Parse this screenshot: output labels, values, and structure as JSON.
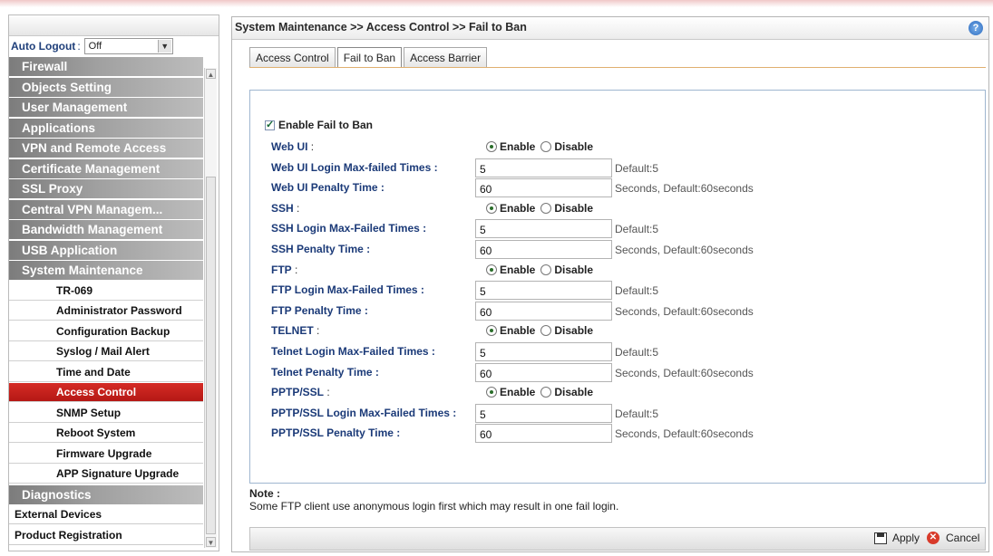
{
  "sidebar": {
    "auto_logout_label": "Auto Logout",
    "auto_logout_value": "Off",
    "menu": [
      {
        "label": "Firewall",
        "kind": "group"
      },
      {
        "label": "Objects Setting",
        "kind": "group"
      },
      {
        "label": "User Management",
        "kind": "group"
      },
      {
        "label": "Applications",
        "kind": "group"
      },
      {
        "label": "VPN and Remote Access",
        "kind": "group"
      },
      {
        "label": "Certificate Management",
        "kind": "group"
      },
      {
        "label": "SSL Proxy",
        "kind": "group"
      },
      {
        "label": "Central VPN Managem...",
        "kind": "group"
      },
      {
        "label": "Bandwidth Management",
        "kind": "group"
      },
      {
        "label": "USB Application",
        "kind": "group"
      },
      {
        "label": "System Maintenance",
        "kind": "group"
      },
      {
        "label": "TR-069",
        "kind": "sub"
      },
      {
        "label": "Administrator Password",
        "kind": "sub"
      },
      {
        "label": "Configuration Backup",
        "kind": "sub"
      },
      {
        "label": "Syslog / Mail Alert",
        "kind": "sub"
      },
      {
        "label": "Time and Date",
        "kind": "sub"
      },
      {
        "label": "Access Control",
        "kind": "sub",
        "active": true
      },
      {
        "label": "SNMP Setup",
        "kind": "sub"
      },
      {
        "label": "Reboot System",
        "kind": "sub"
      },
      {
        "label": "Firmware Upgrade",
        "kind": "sub"
      },
      {
        "label": "APP Signature Upgrade",
        "kind": "sub"
      },
      {
        "label": "Diagnostics",
        "kind": "group"
      },
      {
        "label": "External Devices",
        "kind": "plain"
      },
      {
        "label": "Product Registration",
        "kind": "plain"
      }
    ]
  },
  "header": {
    "breadcrumb": "System Maintenance >> Access Control >> Fail to Ban",
    "help_icon": "help-icon"
  },
  "tabs": [
    {
      "label": "Access Control"
    },
    {
      "label": "Fail to Ban",
      "active": true
    },
    {
      "label": "Access Barrier"
    }
  ],
  "form": {
    "enable_label": "Enable Fail to Ban",
    "enable_checked": true,
    "enable_text": "Enable",
    "disable_text": "Disable",
    "rows": [
      {
        "type": "radio",
        "label": "Web UI",
        "value": "Enable"
      },
      {
        "type": "input",
        "label": "Web UI Login Max-failed Times :",
        "value": "5",
        "hint": "Default:5"
      },
      {
        "type": "input",
        "label": "Web UI Penalty Time :",
        "value": "60",
        "hint": "Seconds, Default:60seconds"
      },
      {
        "type": "radio",
        "label": "SSH",
        "value": "Enable"
      },
      {
        "type": "input",
        "label": "SSH Login Max-Failed Times :",
        "value": "5",
        "hint": "Default:5"
      },
      {
        "type": "input",
        "label": "SSH Penalty Time :",
        "value": "60",
        "hint": "Seconds, Default:60seconds"
      },
      {
        "type": "radio",
        "label": "FTP",
        "value": "Enable"
      },
      {
        "type": "input",
        "label": "FTP Login Max-Failed Times :",
        "value": "5",
        "hint": "Default:5"
      },
      {
        "type": "input",
        "label": "FTP Penalty Time :",
        "value": "60",
        "hint": "Seconds, Default:60seconds"
      },
      {
        "type": "radio",
        "label": "TELNET",
        "value": "Enable"
      },
      {
        "type": "input",
        "label": "Telnet Login Max-Failed Times :",
        "value": "5",
        "hint": "Default:5"
      },
      {
        "type": "input",
        "label": "Telnet Penalty Time :",
        "value": "60",
        "hint": "Seconds, Default:60seconds"
      },
      {
        "type": "radio",
        "label": "PPTP/SSL",
        "value": "Enable"
      },
      {
        "type": "input",
        "label": "PPTP/SSL Login Max-Failed Times :",
        "value": "5",
        "hint": "Default:5"
      },
      {
        "type": "input",
        "label": "PPTP/SSL Penalty Time :",
        "value": "60",
        "hint": "Seconds, Default:60seconds"
      }
    ]
  },
  "note": {
    "heading": "Note :",
    "text": "Some FTP client use anonymous login first which may result in one fail login."
  },
  "footer": {
    "apply_label": "Apply",
    "cancel_label": "Cancel"
  },
  "colors": {
    "active_menu": "#c8201c",
    "label_blue": "#1b3a78"
  }
}
